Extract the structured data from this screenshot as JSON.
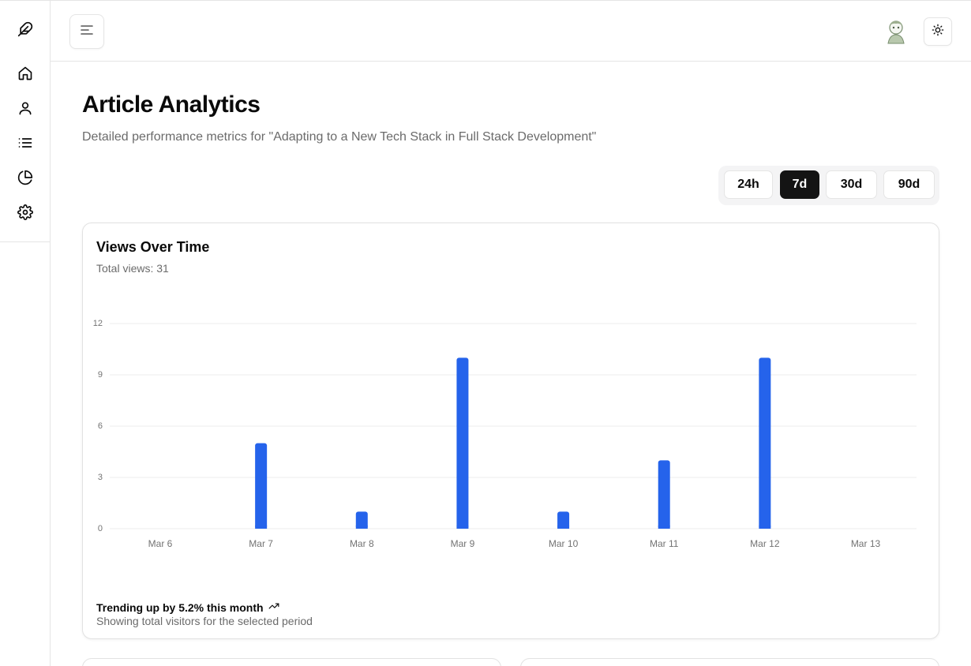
{
  "nav": {
    "items": [
      {
        "name": "home",
        "icon": "home-icon"
      },
      {
        "name": "profile",
        "icon": "user-icon"
      },
      {
        "name": "articles",
        "icon": "list-icon"
      },
      {
        "name": "analytics",
        "icon": "pie-chart-icon"
      },
      {
        "name": "settings",
        "icon": "gear-icon"
      }
    ]
  },
  "header": {
    "menu_icon": "menu-icon",
    "theme_icon": "sun-icon"
  },
  "page": {
    "title": "Article Analytics",
    "subtitle": "Detailed performance metrics for \"Adapting to a New Tech Stack in Full Stack Development\""
  },
  "range": {
    "options": [
      "24h",
      "7d",
      "30d",
      "90d"
    ],
    "selected": "7d"
  },
  "card": {
    "title": "Views Over Time",
    "description": "Total views: 31",
    "trend_text": "Trending up by 5.2% this month",
    "footer_text": "Showing total visitors for the selected period"
  },
  "chart_data": {
    "type": "bar",
    "categories": [
      "Mar 6",
      "Mar 7",
      "Mar 8",
      "Mar 9",
      "Mar 10",
      "Mar 11",
      "Mar 12",
      "Mar 13"
    ],
    "values": [
      0,
      5,
      1,
      10,
      1,
      4,
      10,
      0
    ],
    "ylim": [
      0,
      12
    ],
    "y_ticks": [
      0,
      3,
      6,
      9,
      12
    ],
    "grid": true,
    "bar_color": "#2563eb",
    "xlabel": "",
    "ylabel": ""
  }
}
